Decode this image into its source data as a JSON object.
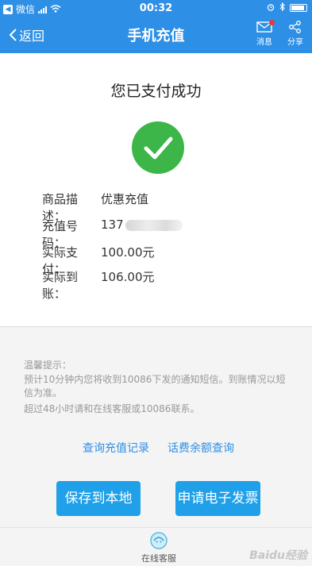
{
  "status_bar": {
    "back_app": "微信",
    "time": "00:32"
  },
  "nav": {
    "back_label": "返回",
    "title": "手机充值",
    "message_label": "消息",
    "share_label": "分享"
  },
  "result": {
    "title": "您已支付成功",
    "rows": [
      {
        "label": "商品描述：",
        "value": "优惠充值"
      },
      {
        "label": "充值号码：",
        "value": "137"
      },
      {
        "label": "实际支付：",
        "value": "100.00元"
      },
      {
        "label": "实际到账：",
        "value": "106.00元"
      }
    ]
  },
  "tips": {
    "heading": "温馨提示：",
    "line1": "预计10分钟内您将收到10086下发的通知短信。到账情况以短信为准。",
    "line2": "超过48小时请和在线客服或10086联系。"
  },
  "links": {
    "records": "查询充值记录",
    "balance": "话费余额查询"
  },
  "buttons": {
    "save": "保存到本地",
    "invoice": "申请电子发票"
  },
  "bottom": {
    "service": "在线客服"
  },
  "watermark": "Baidu经验",
  "colors": {
    "brand": "#2e8fe6",
    "button": "#1fa0e8",
    "success": "#3cb648"
  }
}
